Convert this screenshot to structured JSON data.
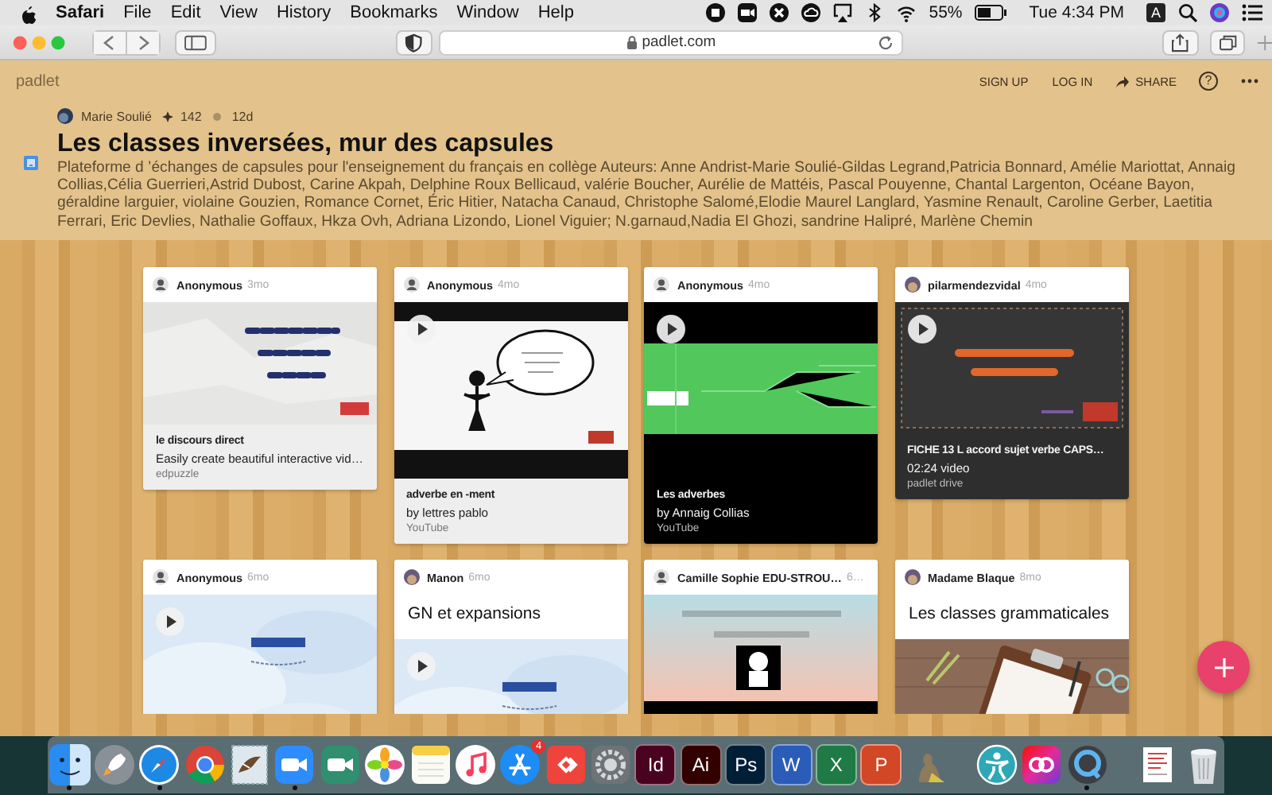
{
  "menubar": {
    "items": [
      {
        "label": "Safari",
        "kind": "app"
      },
      {
        "label": "File",
        "kind": "menu"
      },
      {
        "label": "Edit",
        "kind": "menu"
      },
      {
        "label": "View",
        "kind": "menu"
      },
      {
        "label": "History",
        "kind": "menu"
      },
      {
        "label": "Bookmarks",
        "kind": "menu"
      },
      {
        "label": "Window",
        "kind": "menu"
      },
      {
        "label": "Help",
        "kind": "menu"
      }
    ],
    "battery": "55%",
    "clock": "Tue 4:34 PM",
    "input": "A"
  },
  "browser": {
    "url": "padlet.com"
  },
  "padlet": {
    "brand": "padlet",
    "actions": [
      "SIGN UP",
      "LOG IN",
      "SHARE"
    ],
    "help": "?",
    "author": "Marie Soulié",
    "likes": "142",
    "age": "12d",
    "title": "Les classes inversées, mur des capsules",
    "description": "Plateforme d ’échanges de capsules pour l'enseignement du français en collège Auteurs: Anne Andrist-Marie Soulié-Gildas Legrand,Patricia Bonnard, Amélie Mariottat, Annaig Collias,Célia Guerrieri,Astrid Dubost, Carine Akpah, Delphine Roux Bellicaud, valérie Boucher, Aurélie de Mattéis, Pascal Pouyenne, Chantal Largenton, Océane Bayon, géraldine larguier, violaine Gouzien, Romance Cornet, Éric Hitier, Natacha Canaud, Christophe Salomé,Elodie Maurel Langlard, Yasmine Renault, Caroline Gerber, Laetitia Ferrari, Eric Devlies, Nathalie Goffaux, Hkza Ovh, Adriana Lizondo, Lionel Viguier; N.garnaud,Nadia El Ghozi, sandrine Halipré, Marlène Chemin"
  },
  "cards": [
    {
      "author": "Anonymous",
      "anonymous": true,
      "age": "3mo",
      "kind": "light",
      "video": false,
      "caption": {
        "title": "le discours direct",
        "text": "Easily create beautiful interactive vid…",
        "source": "edpuzzle"
      }
    },
    {
      "author": "Anonymous",
      "anonymous": true,
      "age": "4mo",
      "kind": "light",
      "video": true,
      "caption": {
        "title": "adverbe en -ment",
        "text": "by lettres pablo",
        "source": "YouTube"
      }
    },
    {
      "author": "Anonymous",
      "anonymous": true,
      "age": "4mo",
      "kind": "black",
      "video": true,
      "caption": {
        "title": "Les adverbes",
        "text": "by Annaig Collias",
        "source": "YouTube"
      }
    },
    {
      "author": "pilarmendezvidal",
      "anonymous": false,
      "age": "4mo",
      "kind": "dark",
      "video": true,
      "caption": {
        "title": "FICHE 13 L accord sujet verbe CAPS…",
        "text": "02:24 video",
        "source": "padlet drive"
      }
    },
    {
      "author": "Anonymous",
      "anonymous": true,
      "age": "6mo",
      "kind": "light",
      "video": true
    },
    {
      "author": "Manon",
      "anonymous": false,
      "age": "6mo",
      "kind": "light",
      "video": true,
      "heading": "GN et expansions"
    },
    {
      "author": "Camille Sophie EDU-STROU…",
      "anonymous": true,
      "age": "6…",
      "kind": "light",
      "video": false
    },
    {
      "author": "Madame Blaque",
      "anonymous": false,
      "age": "8mo",
      "kind": "light",
      "video": false,
      "heading": "Les classes grammaticales"
    }
  ],
  "dock": [
    {
      "kind": "finder",
      "running": true
    },
    {
      "kind": "rocket",
      "running": false
    },
    {
      "kind": "compass",
      "running": true
    },
    {
      "kind": "wheel",
      "running": false
    },
    {
      "kind": "bird",
      "running": false
    },
    {
      "kind": "camera",
      "color": "#2d8cff",
      "running": true
    },
    {
      "kind": "camera",
      "color": "#2f8f6e",
      "running": false
    },
    {
      "kind": "flower",
      "running": false
    },
    {
      "kind": "notes",
      "running": false
    },
    {
      "kind": "music",
      "running": false
    },
    {
      "kind": "store",
      "running": false,
      "badge": "4"
    },
    {
      "kind": "diamond",
      "running": false
    },
    {
      "kind": "gear",
      "running": false
    },
    {
      "kind": "letter",
      "label": "Id",
      "color": "#49021f",
      "running": false
    },
    {
      "kind": "letter",
      "label": "Ai",
      "color": "#330000",
      "running": false
    },
    {
      "kind": "letter",
      "label": "Ps",
      "color": "#001e36",
      "running": false
    },
    {
      "kind": "letter",
      "label": "W",
      "color": "#2b5cb8",
      "running": false
    },
    {
      "kind": "letter",
      "label": "X",
      "color": "#1f7a45",
      "running": false
    },
    {
      "kind": "letter",
      "label": "P",
      "color": "#d24726",
      "running": false
    },
    {
      "kind": "statue",
      "running": false
    },
    {
      "kind": "separator"
    },
    {
      "kind": "figure",
      "running": false
    },
    {
      "kind": "rainbow",
      "running": false
    },
    {
      "kind": "ring",
      "running": true
    },
    {
      "kind": "separator"
    },
    {
      "kind": "document",
      "running": false
    },
    {
      "kind": "trash",
      "running": false
    }
  ]
}
